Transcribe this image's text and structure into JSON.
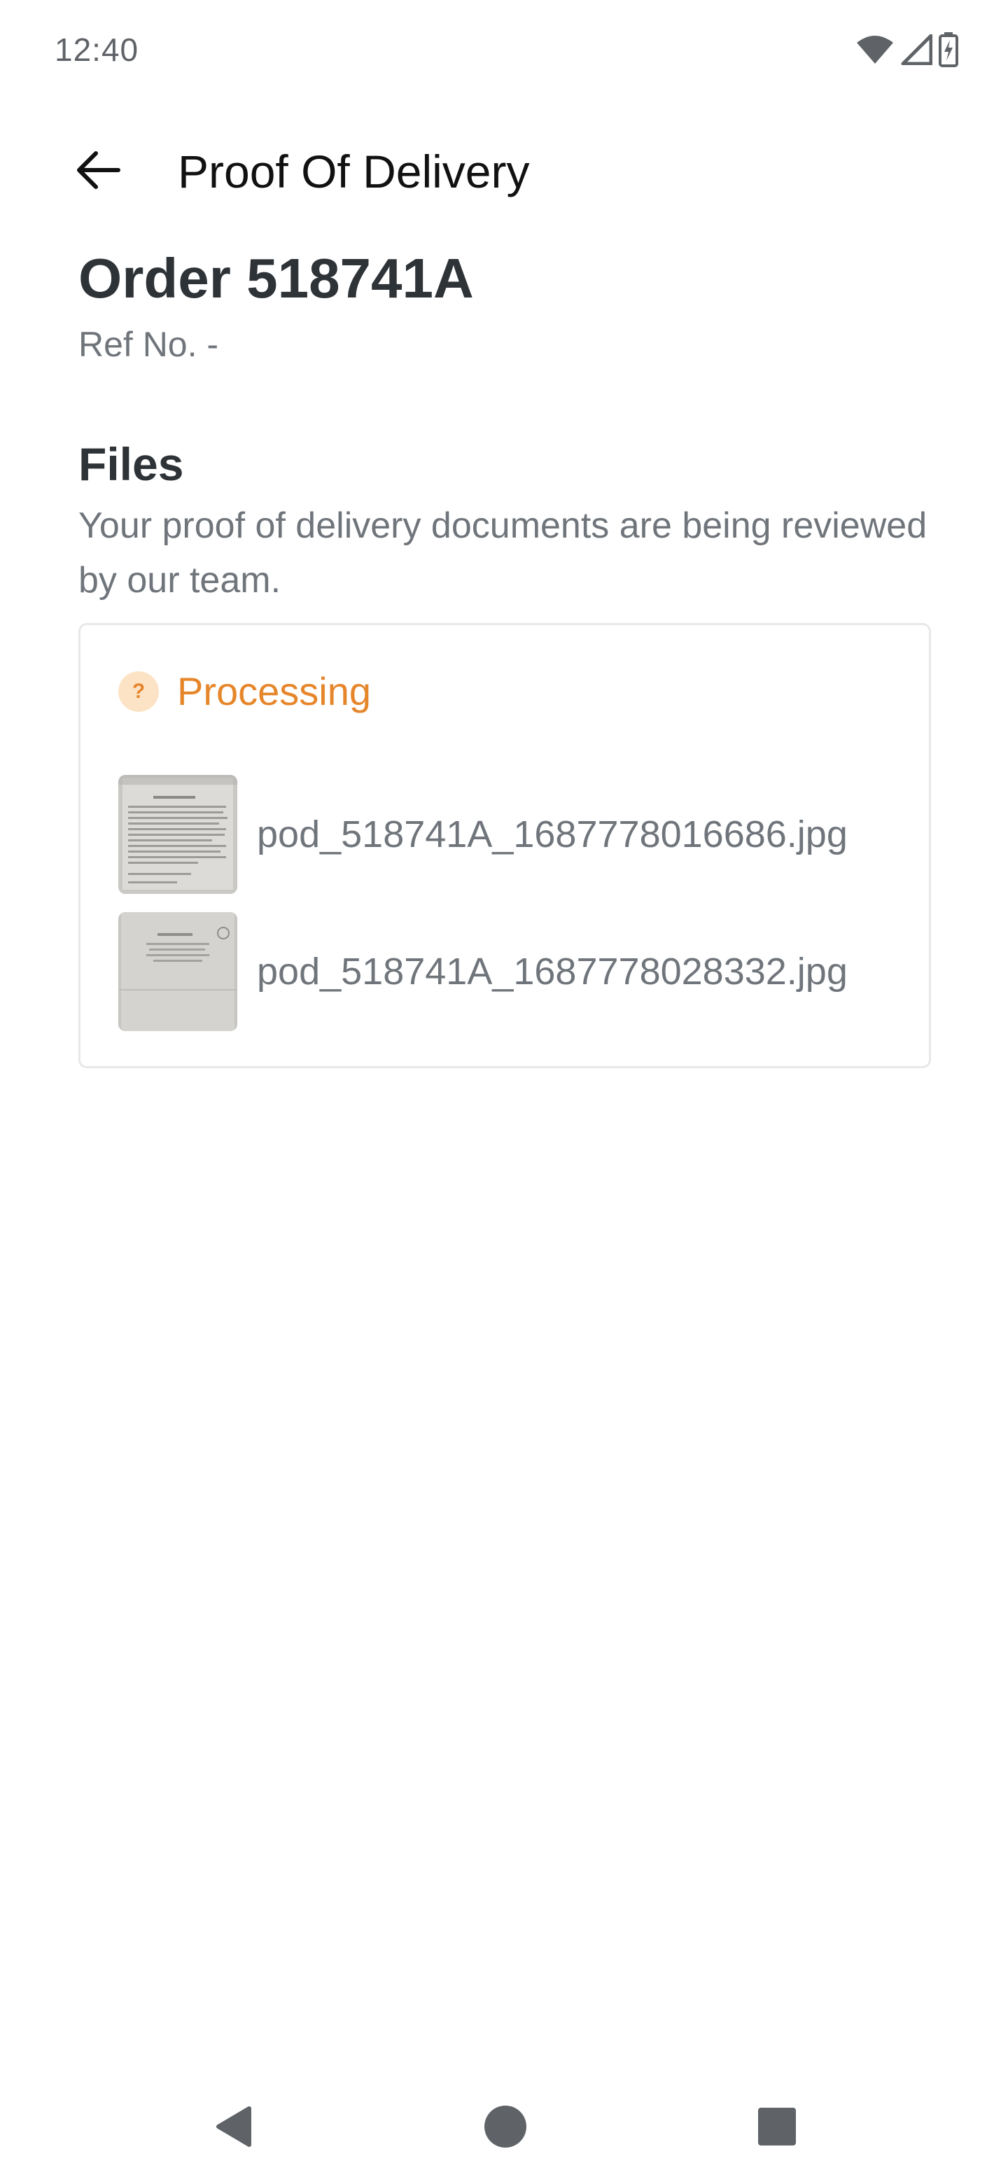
{
  "status_bar": {
    "time": "12:40",
    "icons": [
      "wifi-icon",
      "cellular-signal-icon",
      "battery-charging-icon"
    ]
  },
  "app_bar": {
    "back_icon": "arrow-left-icon",
    "title": "Proof Of Delivery"
  },
  "order": {
    "title": "Order 518741A",
    "ref_no": "Ref No. -"
  },
  "files": {
    "heading": "Files",
    "description": "Your proof of delivery documents are being reviewed by our team.",
    "status": {
      "icon": "question-icon",
      "icon_glyph": "?",
      "label": "Processing",
      "color": "#e6862b"
    },
    "items": [
      {
        "name": "pod_518741A_1687778016686.jpg"
      },
      {
        "name": "pod_518741A_1687778028332.jpg"
      }
    ]
  },
  "nav_bar": {
    "buttons": [
      "back-triangle-icon",
      "home-circle-icon",
      "recents-square-icon"
    ]
  }
}
